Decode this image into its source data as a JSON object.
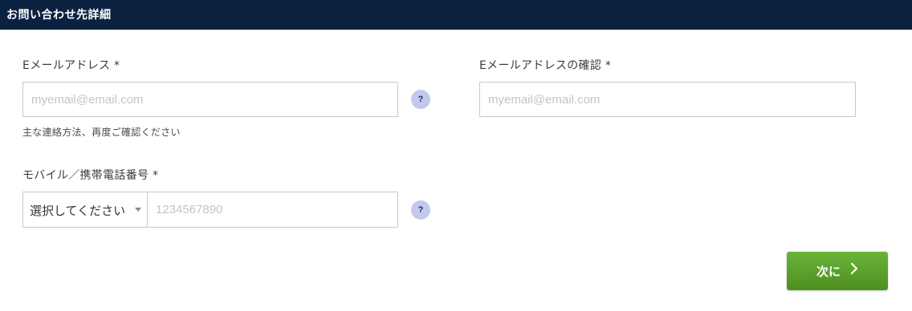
{
  "header": {
    "title": "お問い合わせ先詳細"
  },
  "form": {
    "email": {
      "label": "Eメールアドレス *",
      "placeholder": "myemail@email.com",
      "hint": "主な連絡方法、再度ご確認ください",
      "help_icon": "?"
    },
    "email_confirm": {
      "label": "Eメールアドレスの確認 *",
      "placeholder": "myemail@email.com"
    },
    "mobile": {
      "label": "モバイル／携帯電話番号 *",
      "country_select": "選択してください",
      "placeholder": "1234567890",
      "help_icon": "?"
    }
  },
  "actions": {
    "next_label": "次に"
  },
  "colors": {
    "header_bg": "#0b2140",
    "next_button": "#5aa12a",
    "help_badge": "#c3c8ee"
  }
}
